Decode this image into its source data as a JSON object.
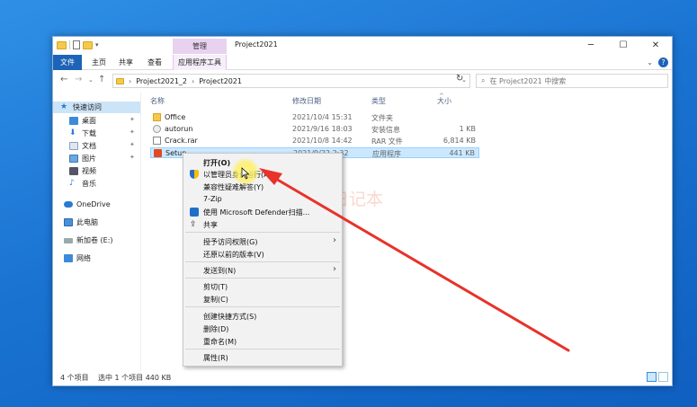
{
  "titlebar": {
    "context_tab_header": "管理",
    "title": "Project2021",
    "minimize": "─",
    "maximize": "☐",
    "close": "✕"
  },
  "ribbon": {
    "tabs": [
      "文件",
      "主页",
      "共享",
      "查看",
      "应用程序工具"
    ],
    "expand": "⌄",
    "help": "?"
  },
  "nav": {
    "back": "←",
    "forward": "→",
    "recent": "⌄",
    "up": "↑",
    "breadcrumb": [
      "Project2021_2",
      "Project2021"
    ],
    "crumb_sep": "›",
    "dropdown": "⌄",
    "refresh": "↻",
    "search_placeholder": "在 Project2021 中搜索",
    "search_icon": "⌕"
  },
  "sidebar": {
    "items": [
      {
        "label": "快速访问",
        "icon": "star-icon"
      },
      {
        "label": "桌面",
        "icon": "desktop-icon",
        "pinned": true
      },
      {
        "label": "下载",
        "icon": "download-icon",
        "pinned": true
      },
      {
        "label": "文档",
        "icon": "documents-icon",
        "pinned": true
      },
      {
        "label": "图片",
        "icon": "pictures-icon",
        "pinned": true
      },
      {
        "label": "视频",
        "icon": "videos-icon"
      },
      {
        "label": "音乐",
        "icon": "music-icon"
      },
      {
        "label": "OneDrive",
        "icon": "onedrive-icon"
      },
      {
        "label": "此电脑",
        "icon": "this-pc-icon"
      },
      {
        "label": "新加卷 (E:)",
        "icon": "drive-icon"
      },
      {
        "label": "网络",
        "icon": "network-icon"
      }
    ],
    "pin_glyph": "✦",
    "star_glyph": "★",
    "download_glyph": "⬇",
    "music_glyph": "♪"
  },
  "filelist": {
    "columns": [
      "名称",
      "修改日期",
      "类型",
      "大小"
    ],
    "sort_indicator": "^",
    "rows": [
      {
        "name": "Office",
        "date": "2021/10/4 15:31",
        "type": "文件夹",
        "size": "",
        "icon": "folder-icon"
      },
      {
        "name": "autorun",
        "date": "2021/9/16 18:03",
        "type": "安装信息",
        "size": "1 KB",
        "icon": "setup-info-icon"
      },
      {
        "name": "Crack.rar",
        "date": "2021/10/8 14:42",
        "type": "RAR 文件",
        "size": "6,814 KB",
        "icon": "rar-icon"
      },
      {
        "name": "Setup",
        "date": "2021/9/22 2:32",
        "type": "应用程序",
        "size": "441 KB",
        "icon": "office-icon"
      }
    ]
  },
  "statusbar": {
    "count": "4 个项目",
    "selected": "选中 1 个项目  440 KB"
  },
  "context_menu": {
    "items": [
      {
        "label": "打开(O)",
        "bold": true
      },
      {
        "label": "以管理员身份运行(A)",
        "icon": "uac-shield-icon"
      },
      {
        "label": "兼容性疑难解答(Y)"
      },
      {
        "label": "7-Zip"
      },
      {
        "label": "使用 Microsoft Defender扫描...",
        "icon": "defender-icon"
      },
      {
        "label": "共享",
        "icon": "share-icon"
      },
      {
        "label": "授予访问权限(G)",
        "submenu": true
      },
      {
        "label": "还原以前的版本(V)"
      },
      {
        "label": "发送到(N)",
        "submenu": true
      },
      {
        "label": "剪切(T)"
      },
      {
        "label": "复制(C)"
      },
      {
        "label": "创建快捷方式(S)"
      },
      {
        "label": "删除(D)"
      },
      {
        "label": "重命名(M)"
      },
      {
        "label": "属性(R)"
      }
    ],
    "submenu_glyph": "›",
    "share_glyph": "⇪"
  },
  "watermark": "江南学日记本",
  "colors": {
    "accent": "#1d63b7",
    "selection": "#cce8ff",
    "annotation_arrow": "#e8322a"
  }
}
